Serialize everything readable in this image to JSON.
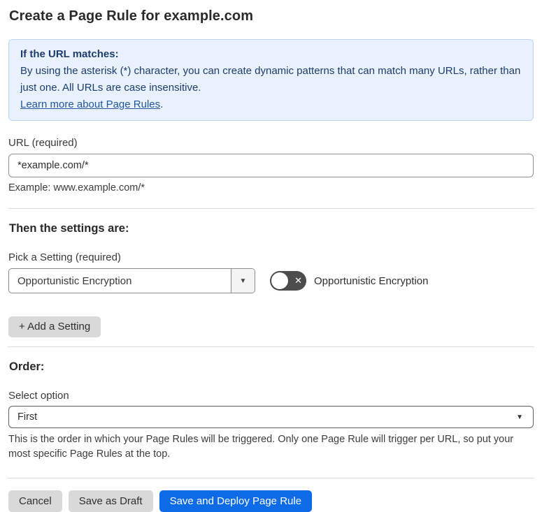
{
  "page": {
    "title": "Create a Page Rule for example.com"
  },
  "info_box": {
    "heading": "If the URL matches:",
    "body": "By using the asterisk (*) character, you can create dynamic patterns that can match many URLs, rather than just one. All URLs are case insensitive.",
    "link_label": "Learn more about Page Rules",
    "link_suffix": "."
  },
  "url_field": {
    "label": "URL (required)",
    "value": "*example.com/*",
    "helper": "Example: www.example.com/*"
  },
  "settings_section": {
    "heading": "Then the settings are:",
    "picker_label": "Pick a Setting (required)",
    "selected_setting": "Opportunistic Encryption",
    "toggle_label": "Opportunistic Encryption",
    "toggle_state": "off",
    "add_button_label": "+ Add a Setting"
  },
  "order_section": {
    "heading": "Order:",
    "select_label": "Select option",
    "selected_option": "First",
    "helper": "This is the order in which your Page Rules will be triggered. Only one Page Rule will trigger per URL, so put your most specific Page Rules at the top."
  },
  "actions": {
    "cancel_label": "Cancel",
    "save_draft_label": "Save as Draft",
    "save_deploy_label": "Save and Deploy Page Rule"
  },
  "icons": {
    "chevron_down": "▼",
    "toggle_x": "✕"
  },
  "colors": {
    "accent_blue": "#0d6be8",
    "info_background": "#e9f2fc",
    "info_border": "#b5d5f2",
    "info_text": "#1c3d6e",
    "link_blue": "#2456a0",
    "toggle_off_background": "#4d4d4d",
    "button_gray": "#d9d9d9"
  }
}
